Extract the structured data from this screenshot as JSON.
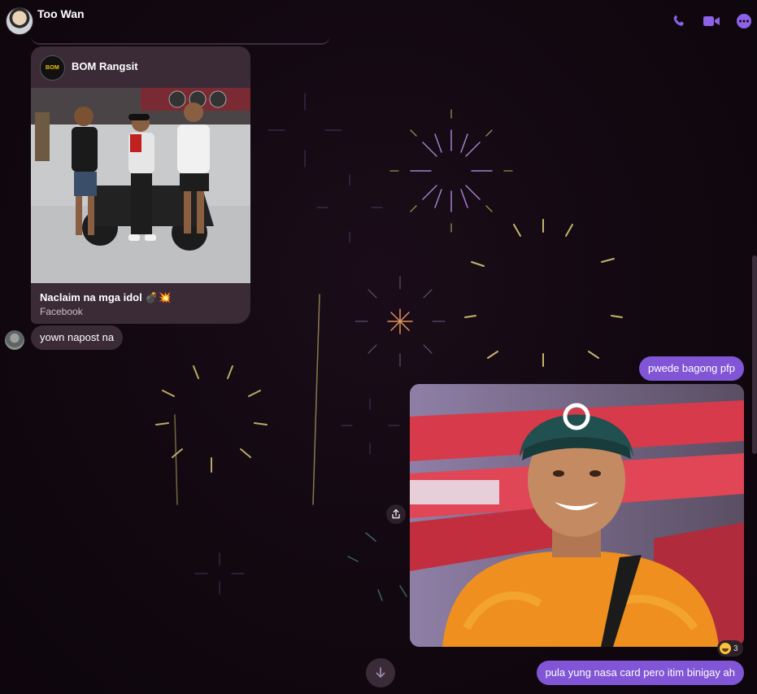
{
  "header": {
    "contact_name": "Too Wan",
    "icons": [
      "phone-icon",
      "video-icon",
      "more-icon"
    ],
    "accent_color": "#8055d6"
  },
  "shared_post": {
    "source_name": "BOM Rangsit",
    "logo_text": "BOM",
    "title": "Naclaim na mga idol 💣💥",
    "subtitle": "Facebook"
  },
  "messages": [
    {
      "id": "m1",
      "direction": "incoming",
      "text": "yown napost na"
    },
    {
      "id": "m2",
      "direction": "outgoing",
      "text": "pwede bagong pfp"
    },
    {
      "id": "m3",
      "direction": "outgoing",
      "type": "image"
    },
    {
      "id": "m4",
      "direction": "outgoing",
      "text": "pula yung nasa card pero itim binigay ah"
    }
  ],
  "reaction": {
    "emoji": "😆",
    "count": "3"
  },
  "controls": {
    "scroll_down_icon": "arrow-down-icon",
    "share_icon": "share-icon"
  }
}
